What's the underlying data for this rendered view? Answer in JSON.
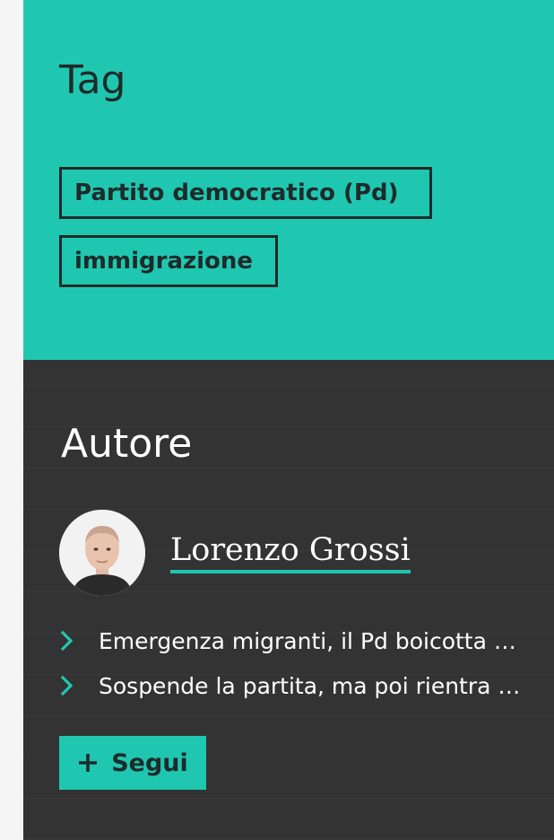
{
  "tags": {
    "heading": "Tag",
    "items": [
      {
        "label": "Partito democratico (Pd)"
      },
      {
        "label": "immigrazione"
      }
    ]
  },
  "author": {
    "heading": "Autore",
    "name": "Lorenzo Grossi",
    "articles": [
      {
        "title": "Emergenza migranti, il Pd boicotta ogni misura"
      },
      {
        "title": "Sospende la partita, ma poi rientra in campo"
      }
    ],
    "follow_label": "Segui"
  },
  "colors": {
    "accent": "#20c7b0",
    "dark_bg": "#333333",
    "text_dark": "#1f2a2a"
  }
}
